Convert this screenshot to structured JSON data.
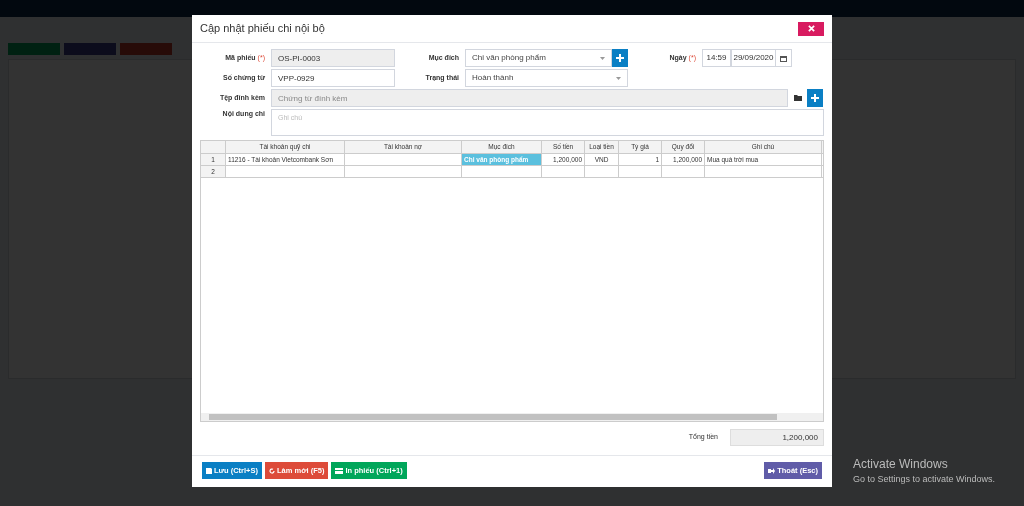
{
  "dialog": {
    "title": "Cập nhật phiếu chi nội bộ"
  },
  "form": {
    "ma_phieu": {
      "label": "Mã phiếu",
      "required_mark": "(*)",
      "value": "OS-PI-0003",
      "readonly": true
    },
    "muc_dich": {
      "label": "Mục đích",
      "value": "Chi văn phòng phẩm"
    },
    "ngay": {
      "label": "Ngày",
      "required_mark": "(*)",
      "time": "14:59",
      "date": "29/09/2020"
    },
    "so_chung_tu": {
      "label": "Số chứng từ",
      "value": "VPP-0929",
      "readonly": false
    },
    "trang_thai": {
      "label": "Trạng thái",
      "value": "Hoàn thành"
    },
    "tep_dinh_kem": {
      "label": "Tệp đính kèm",
      "placeholder": "Chứng từ đính kèm"
    },
    "noi_dung_chi": {
      "label": "Nội dung chi",
      "placeholder": "Ghi chú"
    }
  },
  "table": {
    "columns": [
      "Tài khoản quỹ chi",
      "Tài khoản nợ",
      "Mục đích",
      "Số tiền",
      "Loại tiền",
      "Tỷ giá",
      "Quy đổi",
      "Ghi chú"
    ],
    "rows": [
      {
        "number": "1",
        "cells": [
          {
            "text": "11216 - Tài khoản Vietcombank Sơn",
            "selected": false
          },
          {
            "text": "",
            "selected": false
          },
          {
            "text": "Chi văn phòng phẩm",
            "selected": true
          },
          {
            "text": "1,200,000",
            "selected": false
          },
          {
            "text": "VND",
            "selected": false
          },
          {
            "text": "1",
            "selected": false
          },
          {
            "text": "1,200,000",
            "selected": false
          },
          {
            "text": "Mua quà trời mua",
            "selected": false
          }
        ]
      },
      {
        "number": "2",
        "cells": []
      }
    ]
  },
  "total": {
    "label": "Tổng tiền",
    "value": "1,200,000"
  },
  "buttons": [
    {
      "kind": "save",
      "label": "Lưu (Ctrl+S)"
    },
    {
      "kind": "refresh",
      "label": "Làm mới (F5)"
    },
    {
      "kind": "print",
      "label": "In phiếu (Ctrl+1)"
    },
    {
      "kind": "exit",
      "label": "Thoát (Esc)"
    }
  ],
  "os_notice": {
    "title": "Activate Windows",
    "subtitle": "Go to Settings to activate Windows."
  }
}
